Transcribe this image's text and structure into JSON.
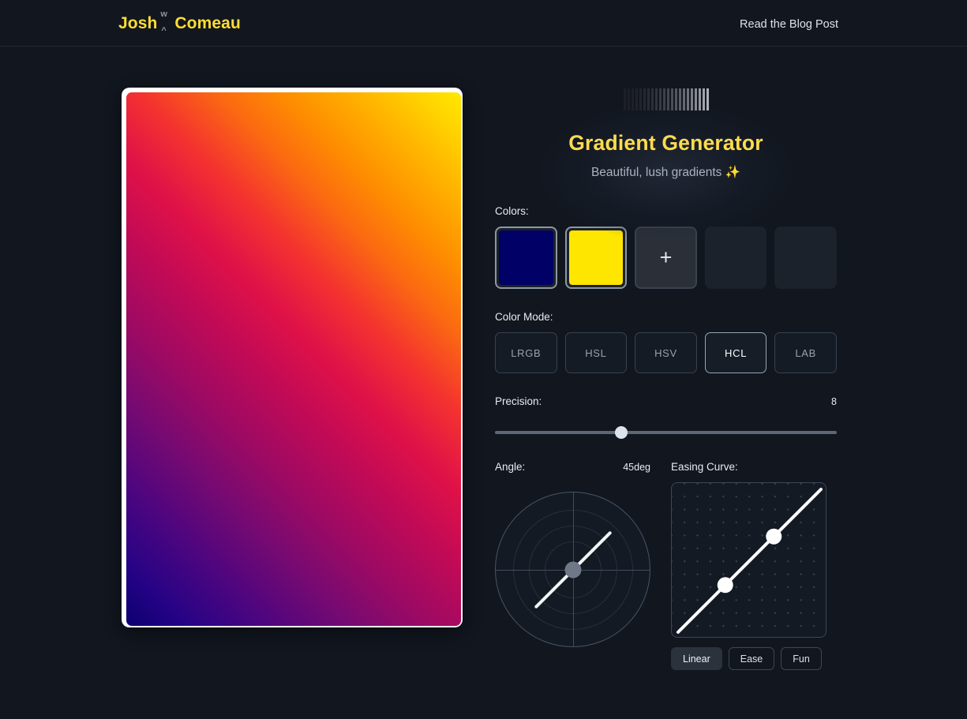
{
  "header": {
    "logo_first": "Josh",
    "logo_mark_top": "w",
    "logo_mark_bottom": "^",
    "logo_last": "Comeau",
    "blog_link": "Read the Blog Post"
  },
  "hero": {
    "title": "Gradient Generator",
    "subtitle": "Beautiful, lush gradients ✨"
  },
  "colors": {
    "label": "Colors:",
    "swatches": [
      {
        "name": "color-swatch-1",
        "hex": "#000066"
      },
      {
        "name": "color-swatch-2",
        "hex": "#FFE600"
      }
    ],
    "add_label": "+",
    "empty_slots": 2
  },
  "color_mode": {
    "label": "Color Mode:",
    "options": [
      "LRGB",
      "HSL",
      "HSV",
      "HCL",
      "LAB"
    ],
    "selected": "HCL"
  },
  "precision": {
    "label": "Precision:",
    "value": "8",
    "percent": 37
  },
  "angle": {
    "label": "Angle:",
    "value": "45deg",
    "degrees": 45
  },
  "easing": {
    "label": "Easing Curve:",
    "buttons": [
      "Linear",
      "Ease",
      "Fun"
    ],
    "selected": "Linear",
    "control_points": [
      {
        "x": 0.33,
        "y": 0.33
      },
      {
        "x": 0.67,
        "y": 0.67
      }
    ]
  },
  "preview": {
    "gradient_from": "#000066",
    "gradient_to": "#FFE600",
    "angle": "45deg"
  },
  "theme": {
    "background": "#11161f",
    "accent": "#FFDC4E",
    "text": "#E8EDF3",
    "muted": "#98A2AF"
  }
}
